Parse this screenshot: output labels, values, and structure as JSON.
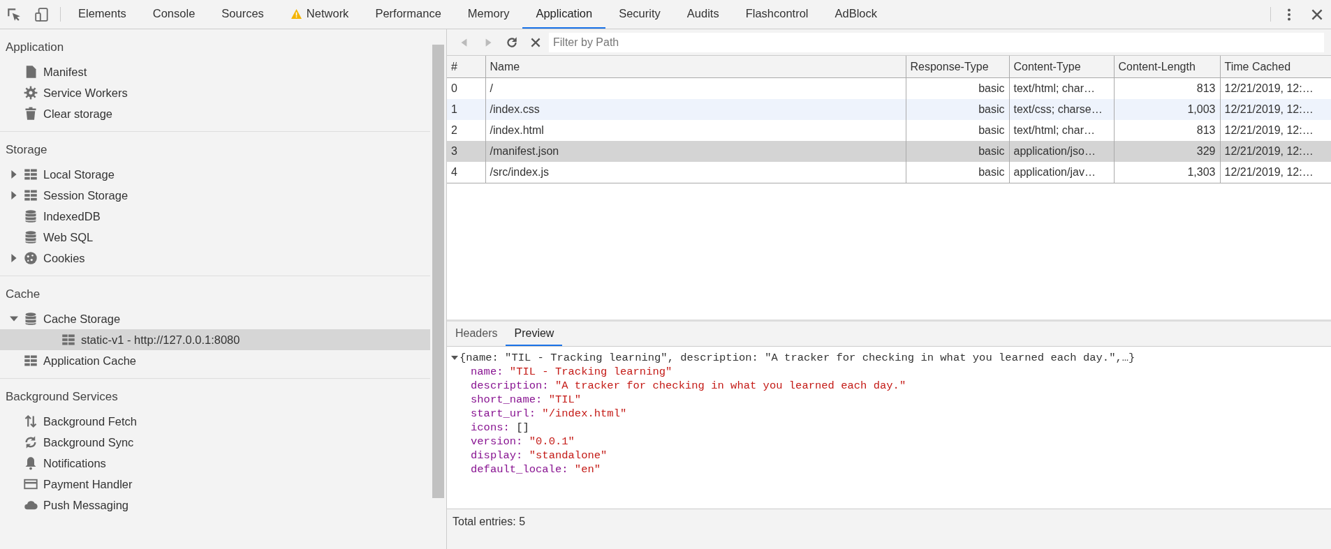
{
  "tabs": [
    {
      "label": "Elements",
      "selected": false,
      "warning": false
    },
    {
      "label": "Console",
      "selected": false,
      "warning": false
    },
    {
      "label": "Sources",
      "selected": false,
      "warning": false
    },
    {
      "label": "Network",
      "selected": false,
      "warning": true
    },
    {
      "label": "Performance",
      "selected": false,
      "warning": false
    },
    {
      "label": "Memory",
      "selected": false,
      "warning": false
    },
    {
      "label": "Application",
      "selected": true,
      "warning": false
    },
    {
      "label": "Security",
      "selected": false,
      "warning": false
    },
    {
      "label": "Audits",
      "selected": false,
      "warning": false
    },
    {
      "label": "Flashcontrol",
      "selected": false,
      "warning": false
    },
    {
      "label": "AdBlock",
      "selected": false,
      "warning": false
    }
  ],
  "sidebar": {
    "sections": [
      {
        "title": "Application",
        "items": [
          {
            "label": "Manifest",
            "kind": "file",
            "selected": false
          },
          {
            "label": "Service Workers",
            "kind": "gear",
            "selected": false
          },
          {
            "label": "Clear storage",
            "kind": "trash",
            "selected": false
          }
        ]
      },
      {
        "title": "Storage",
        "items": [
          {
            "label": "Local Storage",
            "kind": "grid",
            "selected": false,
            "expanded": false
          },
          {
            "label": "Session Storage",
            "kind": "grid",
            "selected": false,
            "expanded": false
          },
          {
            "label": "IndexedDB",
            "kind": "db",
            "selected": false
          },
          {
            "label": "Web SQL",
            "kind": "db",
            "selected": false
          },
          {
            "label": "Cookies",
            "kind": "cookie",
            "selected": false,
            "expanded": false
          }
        ]
      },
      {
        "title": "Cache",
        "items": [
          {
            "label": "Cache Storage",
            "kind": "db",
            "selected": false,
            "expanded": true,
            "children": [
              {
                "label": "static-v1 - http://127.0.0.1:8080",
                "kind": "grid",
                "selected": true
              }
            ]
          },
          {
            "label": "Application Cache",
            "kind": "grid",
            "selected": false
          }
        ]
      },
      {
        "title": "Background Services",
        "items": [
          {
            "label": "Background Fetch",
            "kind": "updown",
            "selected": false
          },
          {
            "label": "Background Sync",
            "kind": "sync",
            "selected": false
          },
          {
            "label": "Notifications",
            "kind": "bell",
            "selected": false
          },
          {
            "label": "Payment Handler",
            "kind": "card",
            "selected": false
          },
          {
            "label": "Push Messaging",
            "kind": "cloud",
            "selected": false
          }
        ]
      }
    ]
  },
  "toolbar": {
    "back_disabled": true,
    "forward_disabled": true,
    "filter": {
      "placeholder": "Filter by Path"
    }
  },
  "table": {
    "columns": [
      "#",
      "Name",
      "Response-Type",
      "Content-Type",
      "Content-Length",
      "Time Cached"
    ],
    "rows": [
      {
        "cells": [
          "0",
          "/",
          "basic",
          "text/html; char…",
          "813",
          "12/21/2019, 12:…"
        ],
        "selected": false,
        "hovered": false
      },
      {
        "cells": [
          "1",
          "/index.css",
          "basic",
          "text/css; charse…",
          "1,003",
          "12/21/2019, 12:…"
        ],
        "selected": false,
        "hovered": true
      },
      {
        "cells": [
          "2",
          "/index.html",
          "basic",
          "text/html; char…",
          "813",
          "12/21/2019, 12:…"
        ],
        "selected": false,
        "hovered": false
      },
      {
        "cells": [
          "3",
          "/manifest.json",
          "basic",
          "application/jso…",
          "329",
          "12/21/2019, 12:…"
        ],
        "selected": true,
        "hovered": false
      },
      {
        "cells": [
          "4",
          "/src/index.js",
          "basic",
          "application/jav…",
          "1,303",
          "12/21/2019, 12:…"
        ],
        "selected": false,
        "hovered": false
      }
    ]
  },
  "preview": {
    "tabs": [
      {
        "label": "Headers",
        "selected": false
      },
      {
        "label": "Preview",
        "selected": true
      }
    ],
    "summary": "{name: \"TIL - Tracking learning\", description: \"A tracker for checking in what you learned each day.\",…}",
    "expanded": true,
    "properties": [
      {
        "key": "name:",
        "value": "\"TIL - Tracking learning\"",
        "kind": "string"
      },
      {
        "key": "description:",
        "value": "\"A tracker for checking in what you learned each day.\"",
        "kind": "string"
      },
      {
        "key": "short_name:",
        "value": "\"TIL\"",
        "kind": "string"
      },
      {
        "key": "start_url:",
        "value": "\"/index.html\"",
        "kind": "string"
      },
      {
        "key": "icons:",
        "value": "[]",
        "kind": "array"
      },
      {
        "key": "version:",
        "value": "\"0.0.1\"",
        "kind": "string"
      },
      {
        "key": "display:",
        "value": "\"standalone\"",
        "kind": "string"
      },
      {
        "key": "default_locale:",
        "value": "\"en\"",
        "kind": "string"
      }
    ]
  },
  "status_bar": {
    "text": "Total entries: 5"
  }
}
